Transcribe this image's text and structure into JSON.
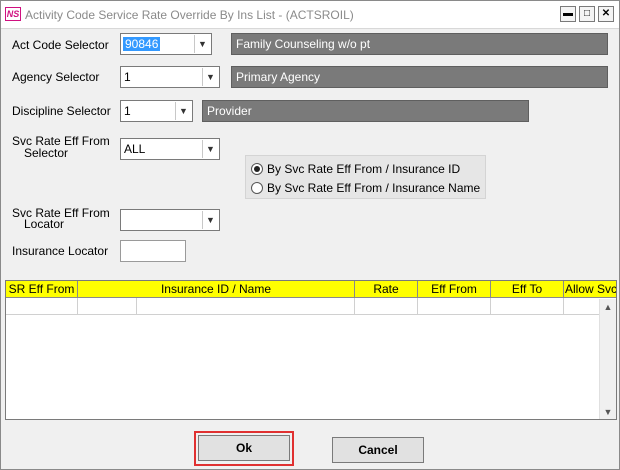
{
  "window": {
    "title": "Activity Code Service Rate Override By Ins List - (ACTSROIL)",
    "app_icon_text": "NS",
    "minimize_glyph": "▬",
    "maximize_glyph": "□",
    "close_glyph": "✕"
  },
  "form": {
    "act_code": {
      "label": "Act Code Selector",
      "value": "90846",
      "description": "Family Counseling w/o pt"
    },
    "agency": {
      "label": "Agency Selector",
      "value": "1",
      "description": "Primary Agency"
    },
    "discipline": {
      "label": "Discipline Selector",
      "value": "1",
      "description": "Provider"
    },
    "svc_rate_from": {
      "label_line1": "Svc Rate Eff From",
      "label_line2": "Selector",
      "value": "ALL"
    },
    "sort_options": [
      {
        "label": "By Svc Rate Eff From / Insurance ID",
        "selected": true
      },
      {
        "label": "By Svc Rate Eff From / Insurance Name",
        "selected": false
      }
    ],
    "svc_rate_locator": {
      "label_line1": "Svc Rate Eff From",
      "label_line2": "Locator",
      "value": ""
    },
    "insurance_locator": {
      "label": "Insurance Locator",
      "value": ""
    }
  },
  "grid": {
    "columns": [
      "SR Eff From",
      "Insurance ID / Name",
      "Rate",
      "Eff From",
      "Eff To",
      "Allow Svc"
    ],
    "header_color": "#ffff00"
  },
  "buttons": {
    "ok": "Ok",
    "cancel": "Cancel"
  },
  "icons": {
    "dropdown": "chevron-down-icon",
    "scroll_up": "scroll-up-icon",
    "scroll_down": "scroll-down-icon"
  }
}
